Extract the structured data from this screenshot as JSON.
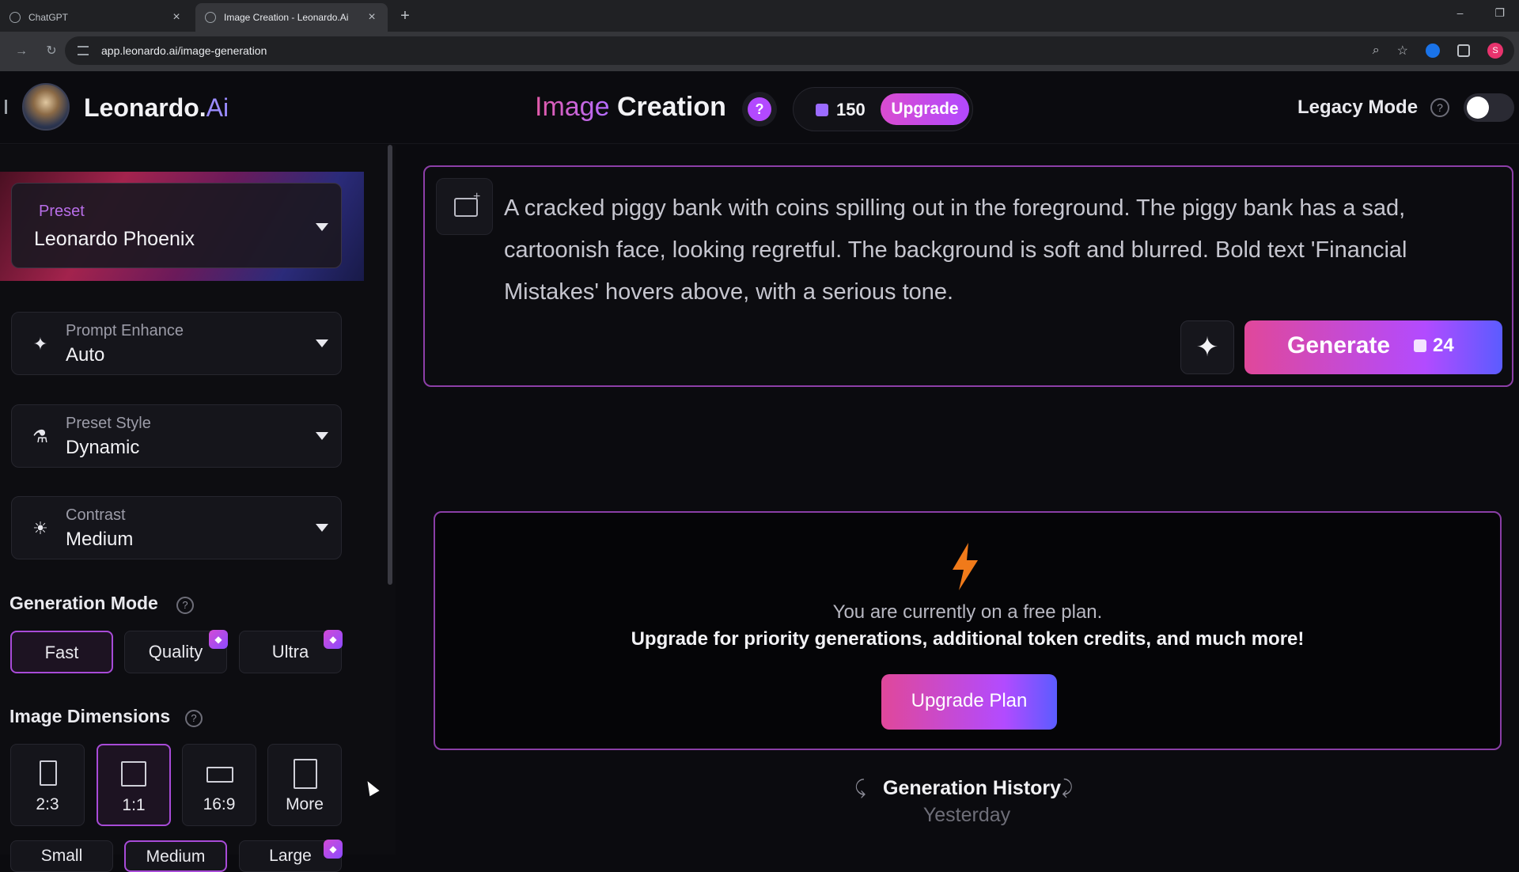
{
  "browser": {
    "tabs": [
      {
        "title": "ChatGPT"
      },
      {
        "title": "Image Creation - Leonardo.Ai"
      }
    ],
    "url": "app.leonardo.ai/image-generation"
  },
  "header": {
    "brand_main": "Leonardo.",
    "brand_suffix": "Ai",
    "title_accent": "Image",
    "title_main": "Creation",
    "help_label": "?",
    "tokens": "150",
    "upgrade_label": "Upgrade",
    "legacy_label": "Legacy Mode",
    "legacy_on": false
  },
  "sidebar": {
    "preset": {
      "label": "Preset",
      "value": "Leonardo Phoenix"
    },
    "prompt_enhance": {
      "label": "Prompt Enhance",
      "value": "Auto"
    },
    "preset_style": {
      "label": "Preset Style",
      "value": "Dynamic"
    },
    "contrast": {
      "label": "Contrast",
      "value": "Medium"
    },
    "generation_mode": {
      "title": "Generation Mode",
      "options": [
        "Fast",
        "Quality",
        "Ultra"
      ],
      "selected": "Fast"
    },
    "image_dimensions": {
      "title": "Image Dimensions",
      "ratios": [
        "2:3",
        "1:1",
        "16:9",
        "More"
      ],
      "selected": "1:1",
      "sizes": [
        "Small",
        "Medium",
        "Large"
      ],
      "selected_size": "Medium"
    }
  },
  "main": {
    "prompt": "A cracked piggy bank with coins spilling out in the foreground. The piggy bank has a sad, cartoonish face, looking regretful. The background is soft and blurred. Bold text 'Financial Mistakes' hovers above, with a serious tone.",
    "generate_label": "Generate",
    "generate_cost": "24",
    "upgrade_panel": {
      "line1": "You are currently on a free plan.",
      "line2": "Upgrade for priority generations, additional token credits, and much more!",
      "button": "Upgrade Plan"
    },
    "history_title": "Generation History",
    "history_day": "Yesterday"
  },
  "colors": {
    "accent_purple": "#b349ff",
    "accent_pink": "#e0489a",
    "border_purple": "#8d3fa8",
    "bolt_orange": "#f07a1a"
  }
}
